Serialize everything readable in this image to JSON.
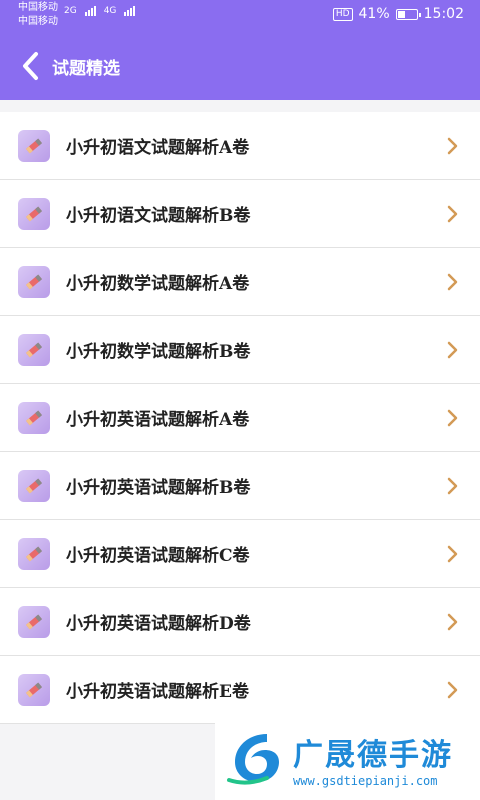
{
  "status_bar": {
    "carrier_1": "中国移动",
    "carrier_2": "中国移动",
    "net_1": "2G",
    "net_2": "4G",
    "hd": "HD",
    "battery": "41%",
    "battery_level": 0.41,
    "time": "15:02"
  },
  "header": {
    "title": "试题精选",
    "background": "#8a6df0"
  },
  "items": [
    {
      "label": "小升初语文试题解析A卷",
      "icon": "pencil-icon"
    },
    {
      "label": "小升初语文试题解析B卷",
      "icon": "pencil-icon"
    },
    {
      "label": "小升初数学试题解析A卷",
      "icon": "pencil-icon"
    },
    {
      "label": "小升初数学试题解析B卷",
      "icon": "pencil-icon"
    },
    {
      "label": "小升初英语试题解析A卷",
      "icon": "pencil-icon"
    },
    {
      "label": "小升初英语试题解析B卷",
      "icon": "pencil-icon"
    },
    {
      "label": "小升初英语试题解析C卷",
      "icon": "pencil-icon"
    },
    {
      "label": "小升初英语试题解析D卷",
      "icon": "pencil-icon"
    },
    {
      "label": "小升初英语试题解析E卷",
      "icon": "pencil-icon"
    }
  ],
  "watermark": {
    "title": "广晟德手游",
    "url": "www.gsdtiepianji.com"
  },
  "colors": {
    "accent": "#8a6df0",
    "chevron": "#d39a55"
  }
}
